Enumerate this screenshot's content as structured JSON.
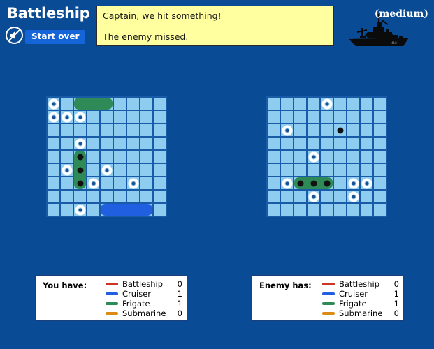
{
  "header": {
    "title": "Battleship",
    "start_over_label": "Start over",
    "sound_icon": "speaker-muted-icon",
    "difficulty": "(medium)",
    "ship_logo_icon": "battleship-silhouette-icon"
  },
  "message": {
    "line1": "Captain, we hit something!",
    "line2": "The enemy missed."
  },
  "colors": {
    "background": "#0a4b96",
    "board_border": "#1a5ba8",
    "cell": "#8fcdf0",
    "message_bg": "#ffffa0",
    "button": "#1565d8",
    "battleship": "#cc3322",
    "cruiser": "#1f5fe0",
    "frigate": "#2e8b57",
    "submarine": "#d98b13",
    "hit": "#111111"
  },
  "boards": {
    "size": 9,
    "player": {
      "label": "player-board",
      "misses": [
        [
          0,
          0
        ],
        [
          1,
          0
        ],
        [
          1,
          1
        ],
        [
          1,
          2
        ],
        [
          3,
          2
        ],
        [
          5,
          1
        ],
        [
          5,
          4
        ],
        [
          6,
          3
        ],
        [
          6,
          6
        ],
        [
          8,
          2
        ]
      ],
      "ships": [
        {
          "name": "frigate",
          "color": "green",
          "row": 0,
          "col": 2,
          "length": 3,
          "orientation": "horizontal",
          "hits": []
        },
        {
          "name": "frigate",
          "color": "green",
          "row": 4,
          "col": 2,
          "length": 3,
          "orientation": "vertical",
          "hits": [
            0,
            1,
            2
          ]
        },
        {
          "name": "cruiser",
          "color": "blue",
          "row": 8,
          "col": 4,
          "length": 4,
          "orientation": "horizontal",
          "hits": []
        }
      ],
      "hits": []
    },
    "enemy": {
      "label": "enemy-board",
      "misses": [
        [
          0,
          4
        ],
        [
          2,
          1
        ],
        [
          4,
          3
        ],
        [
          6,
          1
        ],
        [
          6,
          6
        ],
        [
          6,
          7
        ],
        [
          7,
          3
        ],
        [
          7,
          6
        ]
      ],
      "ships": [
        {
          "name": "frigate",
          "color": "green",
          "row": 6,
          "col": 2,
          "length": 3,
          "orientation": "horizontal",
          "hits": [
            0,
            1,
            2
          ]
        }
      ],
      "hits": [
        [
          2,
          5
        ]
      ]
    }
  },
  "legends": [
    {
      "id": "legend-player",
      "title": "You have:",
      "rows": [
        {
          "name": "Battleship",
          "count": "0",
          "color": "#cc3322"
        },
        {
          "name": "Cruiser",
          "count": "1",
          "color": "#1f5fe0"
        },
        {
          "name": "Frigate",
          "count": "1",
          "color": "#2e8b57"
        },
        {
          "name": "Submarine",
          "count": "0",
          "color": "#d98b13"
        }
      ]
    },
    {
      "id": "legend-enemy",
      "title": "Enemy has:",
      "rows": [
        {
          "name": "Battleship",
          "count": "0",
          "color": "#cc3322"
        },
        {
          "name": "Cruiser",
          "count": "1",
          "color": "#1f5fe0"
        },
        {
          "name": "Frigate",
          "count": "1",
          "color": "#2e8b57"
        },
        {
          "name": "Submarine",
          "count": "0",
          "color": "#d98b13"
        }
      ]
    }
  ]
}
